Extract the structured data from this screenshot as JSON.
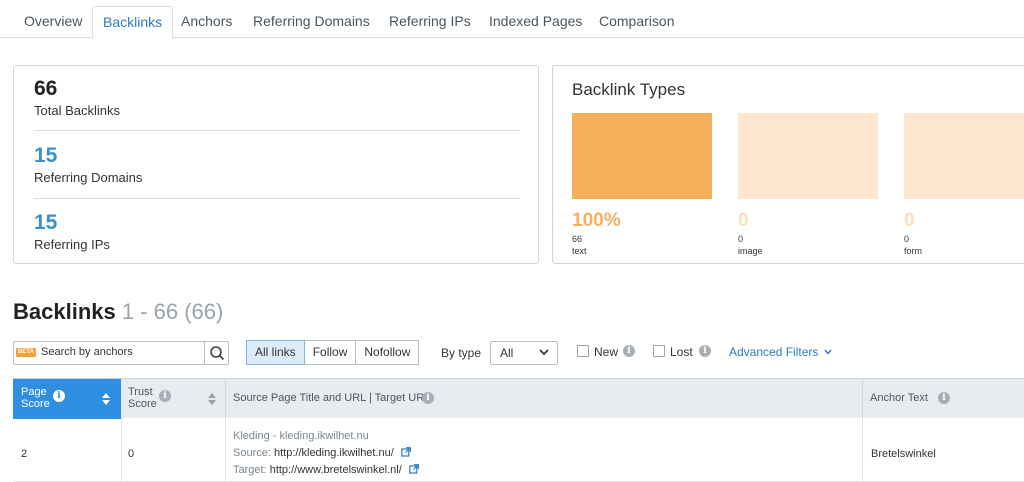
{
  "tabs": [
    {
      "label": "Overview",
      "active": false
    },
    {
      "label": "Backlinks",
      "active": true
    },
    {
      "label": "Anchors",
      "active": false
    },
    {
      "label": "Referring Domains",
      "active": false
    },
    {
      "label": "Referring IPs",
      "active": false
    },
    {
      "label": "Indexed Pages",
      "active": false
    },
    {
      "label": "Comparison",
      "active": false
    }
  ],
  "summary": {
    "total_backlinks": {
      "value": "66",
      "label": "Total Backlinks"
    },
    "referring_domains": {
      "value": "15",
      "label": "Referring Domains"
    },
    "referring_ips": {
      "value": "15",
      "label": "Referring IPs"
    }
  },
  "backlink_types": {
    "title": "Backlink Types",
    "items": [
      {
        "percent": "100%",
        "count": "66",
        "name": "text",
        "color": "#f6b05a"
      },
      {
        "percent": "0",
        "count": "0",
        "name": "image",
        "color": "#fde6cd"
      },
      {
        "percent": "0",
        "count": "0",
        "name": "form",
        "color": "#fde6cd"
      }
    ]
  },
  "backlinks": {
    "heading": "Backlinks",
    "range": "1 - 66 (66)"
  },
  "filters": {
    "beta_badge": "BETA",
    "search_placeholder": "Search by anchors",
    "link_buttons": [
      "All links",
      "Follow",
      "Nofollow"
    ],
    "by_type_label": "By type",
    "type_value": "All",
    "new_label": "New",
    "lost_label": "Lost",
    "advanced_label": "Advanced Filters"
  },
  "table": {
    "headers": {
      "page_score_line1": "Page",
      "page_score_line2": "Score",
      "trust_score_line1": "Trust",
      "trust_score_line2": "Score",
      "source": "Source Page Title and URL | Target URL",
      "anchor": "Anchor Text"
    },
    "rows": [
      {
        "page_score": "2",
        "trust_score": "0",
        "title": "Kleding - kleding.ikwilhet.nu",
        "source_label": "Source:",
        "source_url": "http://kleding.ikwilhet.nu/",
        "target_label": "Target:",
        "target_url": "http://www.bretelswinkel.nl/",
        "anchor": "Bretelswinkel"
      }
    ]
  },
  "colors": {
    "accent_blue": "#2e8fe0",
    "link_blue": "#2b7bbf",
    "orange": "#f6b05a"
  }
}
